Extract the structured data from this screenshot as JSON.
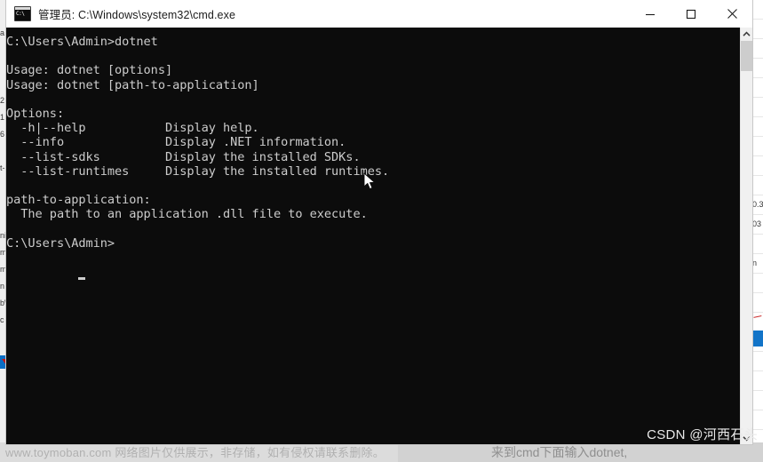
{
  "window": {
    "title": "管理员: C:\\Windows\\system32\\cmd.exe",
    "icon": "cmd-icon",
    "controls": {
      "minimize": "minimize-button",
      "maximize": "maximize-button",
      "close": "close-button"
    }
  },
  "terminal": {
    "prompt_path": "C:\\Users\\Admin>",
    "command": "dotnet",
    "cursor": "block-cursor",
    "lines": [
      "C:\\Users\\Admin>dotnet",
      "",
      "Usage: dotnet [options]",
      "Usage: dotnet [path-to-application]",
      "",
      "Options:",
      "  -h|--help           Display help.",
      "  --info              Display .NET information.",
      "  --list-sdks         Display the installed SDKs.",
      "  --list-runtimes     Display the installed runtimes.",
      "",
      "path-to-application:",
      "  The path to an application .dll file to execute.",
      "",
      "C:\\Users\\Admin>"
    ],
    "usage": [
      "Usage: dotnet [options]",
      "Usage: dotnet [path-to-application]"
    ],
    "options_heading": "Options:",
    "options": [
      {
        "flag": "-h|--help",
        "description": "Display help."
      },
      {
        "flag": "--info",
        "description": "Display .NET information."
      },
      {
        "flag": "--list-sdks",
        "description": "Display the installed SDKs."
      },
      {
        "flag": "--list-runtimes",
        "description": "Display the installed runtimes."
      }
    ],
    "path_section_heading": "path-to-application:",
    "path_section_body": "  The path to an application .dll file to execute.",
    "scrollbar": {
      "up_arrow": "scroll-up-arrow",
      "down_arrow": "scroll-down-arrow",
      "thumb": "scroll-thumb"
    }
  },
  "background": {
    "left_column_rows": [
      "a",
      "",
      "",
      "",
      "2",
      "1",
      "6",
      "",
      "t-",
      "",
      "",
      "",
      "ni",
      "m",
      "m",
      "n",
      "b\\",
      "c",
      "",
      ""
    ],
    "right_column_rows": [
      "",
      "",
      "",
      "",
      "",
      "",
      "",
      "",
      "",
      "",
      "0.3",
      "03",
      "",
      "n",
      "",
      "",
      "",
      "",
      "",
      "",
      "",
      ""
    ],
    "bottom_text": "www.toymoban.com 网络图片仅供展示，非存储，如有侵权请联系删除。",
    "mid_text": "来到cmd下面输入dotnet,"
  },
  "watermark": {
    "csdn": "CSDN @河西石头"
  },
  "colors": {
    "terminal_bg": "#0c0c0c",
    "terminal_fg": "#cccccc",
    "titlebar_bg": "#ffffff",
    "accent_blue": "#1274c8"
  }
}
